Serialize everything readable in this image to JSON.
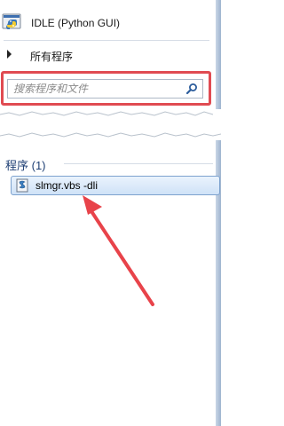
{
  "start_menu": {
    "pinned_item_label": "IDLE (Python GUI)",
    "all_programs_label": "所有程序",
    "search": {
      "placeholder": "搜索程序和文件",
      "value": ""
    }
  },
  "results": {
    "group_header": "程序 (1)",
    "items": [
      {
        "label": "slmgr.vbs -dli",
        "icon": "vbs-script-icon"
      }
    ]
  },
  "colors": {
    "highlight_box": "#e04b52",
    "annotation_arrow": "#e8434a",
    "group_header_text": "#1e3f74",
    "selection_border": "#7da2ce"
  }
}
